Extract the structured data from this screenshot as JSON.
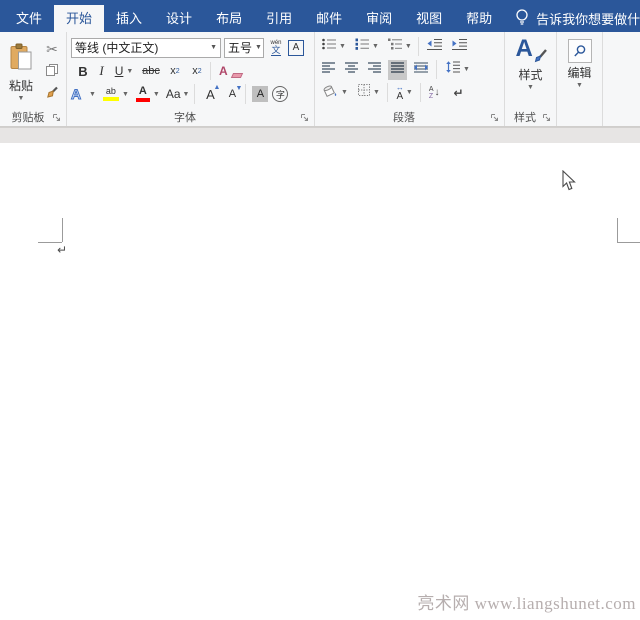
{
  "ribbon_tabs": [
    {
      "label": "文件",
      "selected": false
    },
    {
      "label": "开始",
      "selected": true
    },
    {
      "label": "插入",
      "selected": false
    },
    {
      "label": "设计",
      "selected": false
    },
    {
      "label": "布局",
      "selected": false
    },
    {
      "label": "引用",
      "selected": false
    },
    {
      "label": "邮件",
      "selected": false
    },
    {
      "label": "审阅",
      "selected": false
    },
    {
      "label": "视图",
      "selected": false
    },
    {
      "label": "帮助",
      "selected": false
    }
  ],
  "tell_me": {
    "text": "告诉我你想要做什"
  },
  "clipboard": {
    "group_label": "剪贴板",
    "paste_label": "粘贴"
  },
  "font": {
    "group_label": "字体",
    "name_value": "等线 (中文正文)",
    "size_value": "五号",
    "phonetic_top": "wén",
    "phonetic_bottom": "文",
    "char_border_glyph": "A",
    "bold_glyph": "B",
    "italic_glyph": "I",
    "underline_glyph": "U",
    "strikethrough_glyph": "abc",
    "subscript_glyph": "x",
    "subscript_mark": "2",
    "superscript_glyph": "x",
    "superscript_mark": "2",
    "clear_format_glyph": "A",
    "text_effects_glyph": "A",
    "highlight_glyph": "ab",
    "font_color_glyph": "A",
    "change_case_glyph": "Aa",
    "grow_font_glyph": "A",
    "grow_arrow": "▲",
    "shrink_font_glyph": "A",
    "shrink_arrow": "▼",
    "char_shading_glyph": "A",
    "enclose_glyph": "字"
  },
  "paragraph": {
    "group_label": "段落",
    "char_scale_arrow": "↔",
    "char_scale_glyph": "A",
    "sort_a_glyph": "A",
    "sort_z_glyph": "Z",
    "sort_arrow": "↓",
    "show_marks_glyph": "↵"
  },
  "styles": {
    "group_label": "样式",
    "button_label": "样式",
    "icon_glyph": "A"
  },
  "editing": {
    "button_label": "编辑"
  },
  "document": {
    "paragraph_mark": "↵",
    "watermark": "亮术网 www.liangshunet.com"
  },
  "colors": {
    "tab_bar_blue": "#2b579a",
    "highlight_yellow": "#ffff00",
    "font_color_red": "#ff0000",
    "accent_blue": "#4472c4",
    "watermark_gray": "#b6aeae"
  }
}
